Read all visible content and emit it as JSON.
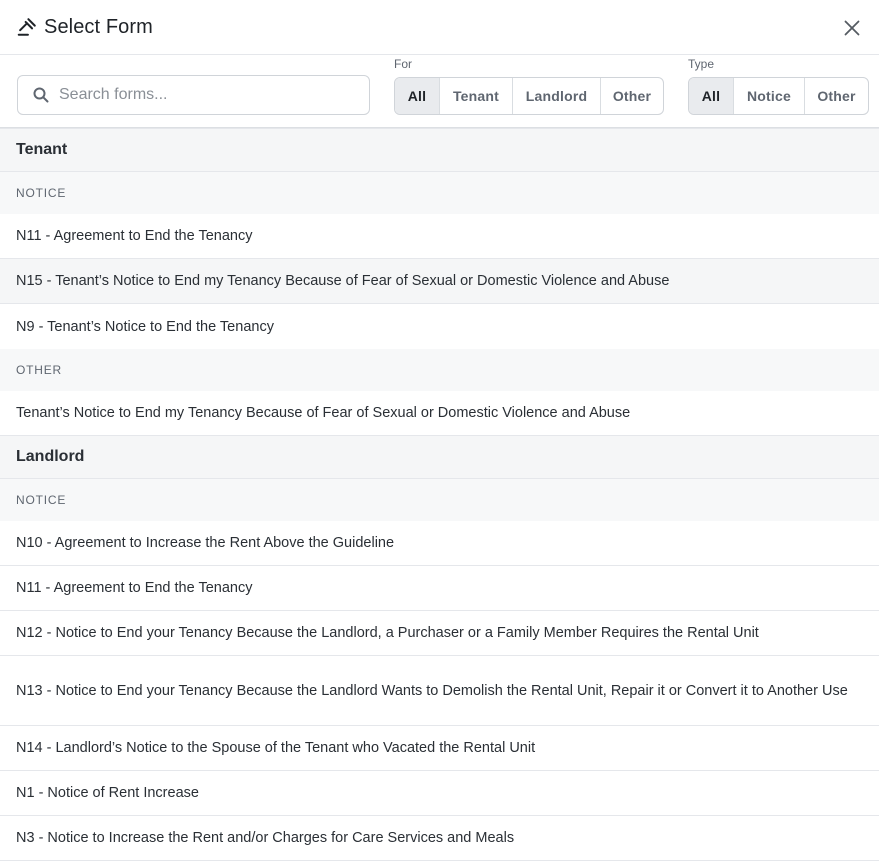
{
  "header": {
    "title": "Select Form",
    "title_icon": "gavel-icon",
    "close_icon": "close-icon"
  },
  "filters": {
    "search": {
      "placeholder": "Search forms...",
      "value": ""
    },
    "for": {
      "label": "For",
      "options": [
        "All",
        "Tenant",
        "Landlord",
        "Other"
      ],
      "selected": "All"
    },
    "type": {
      "label": "Type",
      "options": [
        "All",
        "Notice",
        "Other"
      ],
      "selected": "All"
    }
  },
  "groups": [
    {
      "title": "Tenant",
      "sections": [
        {
          "label": "NOTICE",
          "items": [
            "N11 - Agreement to End the Tenancy",
            "N15 - Tenant’s Notice to End my Tenancy Because of Fear of Sexual or Domestic Violence and Abuse",
            "N9 - Tenant’s Notice to End the Tenancy"
          ]
        },
        {
          "label": "OTHER",
          "items": [
            "Tenant’s Notice to End my Tenancy Because of Fear of Sexual or Domestic Violence and Abuse"
          ]
        }
      ]
    },
    {
      "title": "Landlord",
      "sections": [
        {
          "label": "NOTICE",
          "items": [
            "N10 - Agreement to Increase the Rent Above the Guideline",
            "N11 - Agreement to End the Tenancy",
            "N12 - Notice to End your Tenancy Because the Landlord, a Purchaser or a Family Member Requires the Rental Unit",
            "N13 - Notice to End your Tenancy Because the Landlord Wants to Demolish the Rental Unit, Repair it or Convert it to Another Use",
            "N14 - Landlord’s Notice to the Spouse of the Tenant who Vacated the Rental Unit",
            "N1 - Notice of Rent Increase",
            "N3 - Notice to Increase the Rent and/or Charges for Care Services and Meals"
          ]
        }
      ]
    }
  ]
}
